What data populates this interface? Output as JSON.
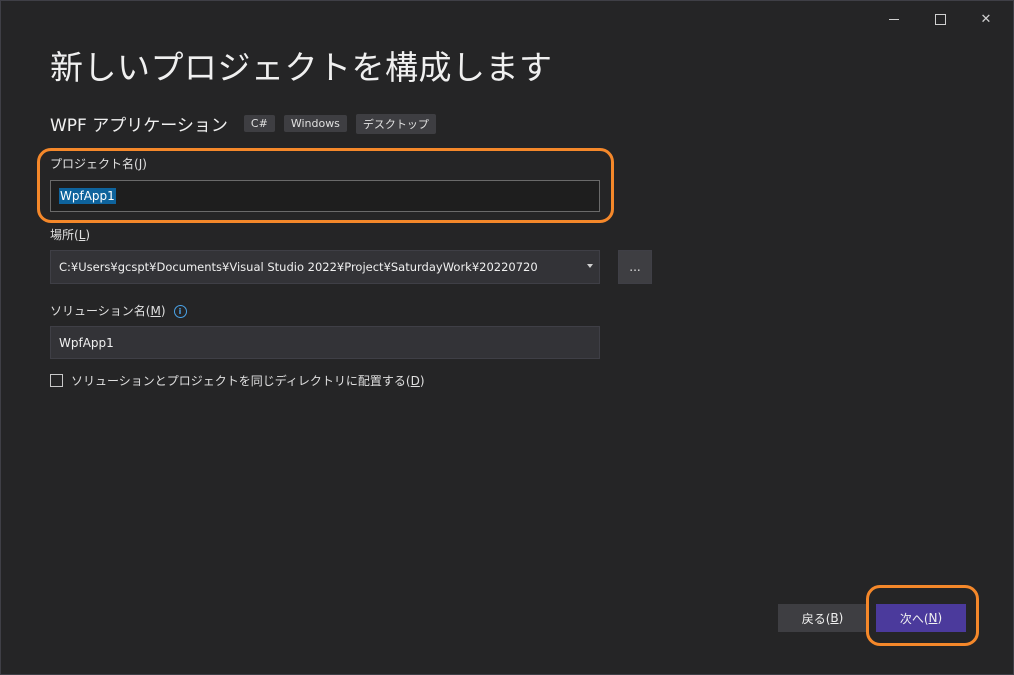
{
  "window": {
    "minimize_icon": "minimize-icon",
    "maximize_icon": "maximize-icon",
    "close_glyph": "✕"
  },
  "page": {
    "title": "新しいプロジェクトを構成します"
  },
  "template": {
    "name": "WPF アプリケーション",
    "tags": [
      "C#",
      "Windows",
      "デスクトップ"
    ]
  },
  "project_name": {
    "label": "プロジェクト名(",
    "mnemonic": "J",
    "label_end": ")",
    "value": "WpfApp1"
  },
  "location": {
    "label": "場所(",
    "mnemonic": "L",
    "label_end": ")",
    "value": "C:¥Users¥gcspt¥Documents¥Visual Studio 2022¥Project¥SaturdayWork¥20220720",
    "browse_label": "..."
  },
  "solution_name": {
    "label": "ソリューション名(",
    "mnemonic": "M",
    "label_end": ")",
    "info_glyph": "i",
    "value": "WpfApp1"
  },
  "same_directory": {
    "label": "ソリューションとプロジェクトを同じディレクトリに配置する(",
    "mnemonic": "D",
    "label_end": ")",
    "checked": false
  },
  "footer": {
    "back_label": "戻る(",
    "back_mnemonic": "B",
    "back_end": ")",
    "next_label": "次へ(",
    "next_mnemonic": "N",
    "next_end": ")"
  },
  "colors": {
    "background": "#252526",
    "accent": "#4b3a9c",
    "highlight": "#f5882a",
    "selection": "#0e639c"
  }
}
